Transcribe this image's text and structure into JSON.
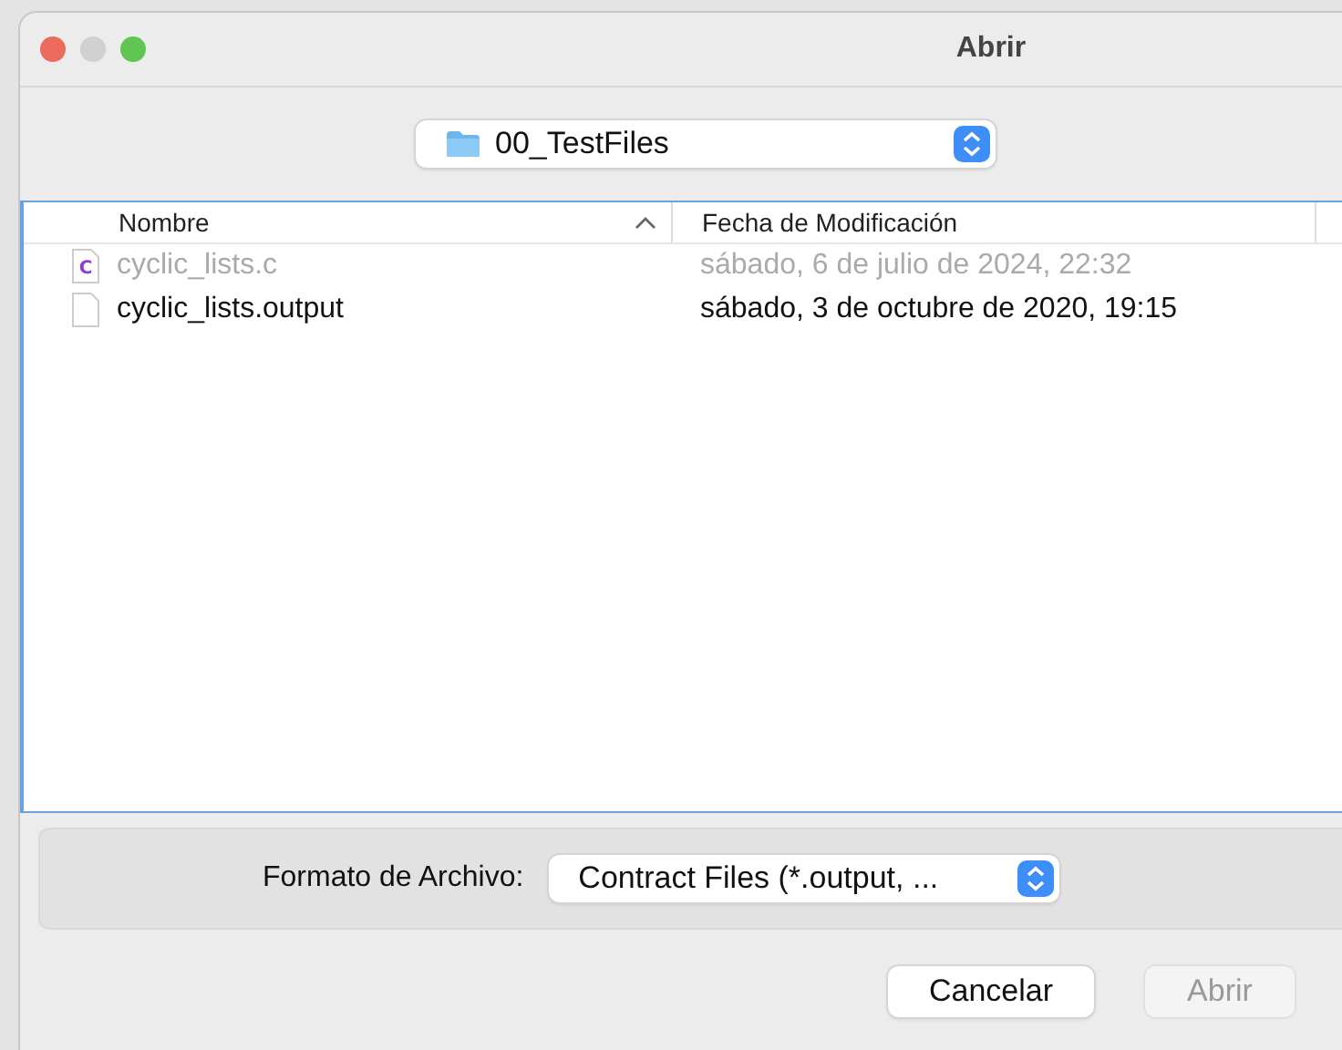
{
  "window": {
    "title": "Abrir"
  },
  "location": {
    "folder": "00_TestFiles"
  },
  "file_list": {
    "columns": [
      {
        "label": "Nombre",
        "sorted": true
      },
      {
        "label": "Fecha de Modificación",
        "sorted": false
      }
    ],
    "rows": [
      {
        "kind": "c-source",
        "icon_letter": "C",
        "name": "cyclic_lists.c",
        "modified": "sábado, 6 de julio de 2024, 22:32",
        "disabled": true
      },
      {
        "kind": "plain",
        "name": "cyclic_lists.output",
        "modified": "sábado, 3 de octubre de 2020, 19:15",
        "disabled": false
      }
    ]
  },
  "format": {
    "label": "Formato de Archivo:",
    "value": "Contract Files (*.output, ..."
  },
  "buttons": [
    {
      "label": "Cancelar",
      "disabled": false
    },
    {
      "label": "Abrir",
      "disabled": true
    }
  ]
}
